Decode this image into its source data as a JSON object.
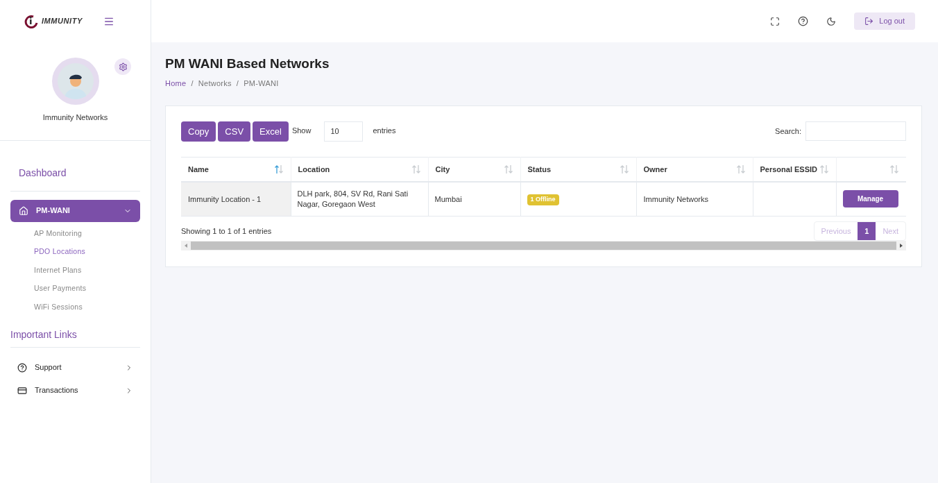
{
  "logo": {
    "text": "IMMUNITY"
  },
  "profile": {
    "name": "Immunity Networks"
  },
  "sidebar": {
    "sections": [
      {
        "title": "Dashboard",
        "items": [
          {
            "label": "PM-WANI",
            "kind": "group",
            "selected": true,
            "expanded": true,
            "children": [
              {
                "label": "AP Monitoring",
                "selected": false
              },
              {
                "label": "PDO Locations",
                "selected": true
              },
              {
                "label": "Internet Plans",
                "selected": false
              },
              {
                "label": "User Payments",
                "selected": false
              },
              {
                "label": "WiFi Sessions",
                "selected": false
              }
            ]
          }
        ]
      },
      {
        "title": "Important Links",
        "items": [
          {
            "label": "Support",
            "kind": "help",
            "selected": false
          },
          {
            "label": "Transactions",
            "kind": "card",
            "selected": false
          }
        ]
      }
    ]
  },
  "topbar": {
    "logout": "Log out"
  },
  "page": {
    "title": "PM WANI Based Networks",
    "breadcrumb": [
      "Home",
      "Networks",
      "PM-WANI"
    ],
    "breadcrumb_separator": "/"
  },
  "table_tools": {
    "buttons": [
      "Copy",
      "CSV",
      "Excel"
    ],
    "show_label": "Show",
    "page_size": "10",
    "entries_label": "entries",
    "search_label": "Search:"
  },
  "table": {
    "columns": [
      {
        "label": "Name",
        "sorted": true
      },
      {
        "label": "Location",
        "sorted": false
      },
      {
        "label": "City",
        "sorted": false
      },
      {
        "label": "Status",
        "sorted": false
      },
      {
        "label": "Owner",
        "sorted": false
      },
      {
        "label": "Personal ESSID",
        "sorted": false
      },
      {
        "sorted": false
      }
    ],
    "rows": [
      {
        "name": "Immunity Location - 1",
        "location": "DLH park, 804, SV Rd, Rani Sati Nagar, Goregaon West",
        "city": "Mumbai",
        "status": "1 Offline",
        "color": "#e0c232",
        "owner": "Immunity Networks",
        "action": "Manage"
      }
    ]
  },
  "footer": {
    "info": "Showing 1 to 1 of 1 entries",
    "pages": [
      {
        "label": "Previous",
        "kind": "nav",
        "disabled": true,
        "selected": false
      },
      {
        "label": "1",
        "kind": "page",
        "disabled": false,
        "selected": true
      },
      {
        "label": "Next",
        "kind": "nav",
        "disabled": true,
        "selected": false
      }
    ]
  }
}
